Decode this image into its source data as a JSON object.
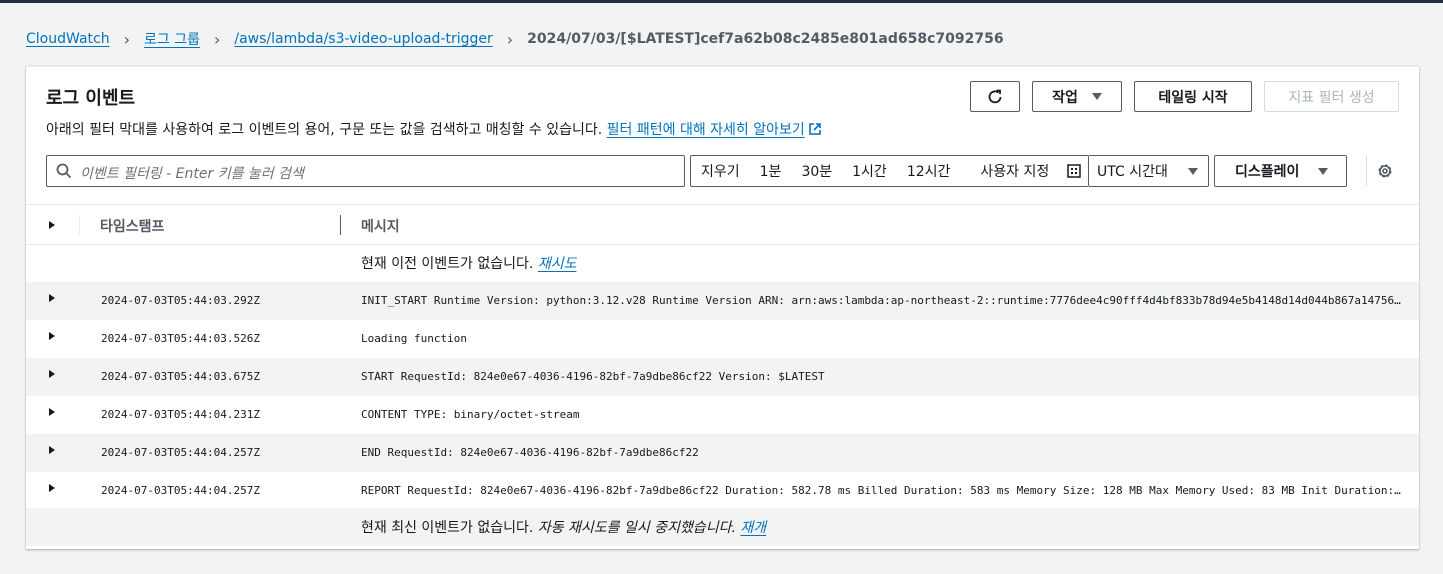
{
  "breadcrumb": {
    "items": [
      "CloudWatch",
      "로그 그룹",
      "/aws/lambda/s3-video-upload-trigger"
    ],
    "current": "2024/07/03/[$LATEST]cef7a62b08c2485e801ad658c7092756"
  },
  "panel": {
    "title": "로그 이벤트",
    "description": "아래의 필터 막대를 사용하여 로그 이벤트의 용어, 구문 또는 값을 검색하고 매칭할 수 있습니다.",
    "learn_link": "필터 패턴에 대해 자세히 알아보기"
  },
  "buttons": {
    "actions": "작업",
    "tailing": "테일링 시작",
    "create_metric_filter": "지표 필터 생성"
  },
  "search": {
    "placeholder": "이벤트 필터링 - Enter 키를 눌러 검색"
  },
  "time_range": {
    "clear": "지우기",
    "options": [
      "1분",
      "30분",
      "1시간",
      "12시간"
    ],
    "custom": "사용자 지정"
  },
  "timezone": "UTC 시간대",
  "display": "디스플레이",
  "table": {
    "columns": [
      "타임스탬프",
      "메시지"
    ],
    "top_notice": "현재 이전 이벤트가 없습니다.",
    "top_retry": "재시도",
    "rows": [
      {
        "timestamp": "2024-07-03T05:44:03.292Z",
        "message": "INIT_START Runtime Version: python:3.12.v28 Runtime Version ARN: arn:aws:lambda:ap-northeast-2::runtime:7776dee4c90fff4d4bf833b78d94e5b4148d14d044b867a14756..."
      },
      {
        "timestamp": "2024-07-03T05:44:03.526Z",
        "message": "Loading function"
      },
      {
        "timestamp": "2024-07-03T05:44:03.675Z",
        "message": "START RequestId: 824e0e67-4036-4196-82bf-7a9dbe86cf22 Version: $LATEST"
      },
      {
        "timestamp": "2024-07-03T05:44:04.231Z",
        "message": "CONTENT TYPE: binary/octet-stream"
      },
      {
        "timestamp": "2024-07-03T05:44:04.257Z",
        "message": "END RequestId: 824e0e67-4036-4196-82bf-7a9dbe86cf22"
      },
      {
        "timestamp": "2024-07-03T05:44:04.257Z",
        "message": "REPORT RequestId: 824e0e67-4036-4196-82bf-7a9dbe86cf22 Duration: 582.78 ms Billed Duration: 583 ms Memory Size: 128 MB Max Memory Used: 83 MB Init Duration:..."
      }
    ],
    "bottom_notice": "현재 최신 이벤트가 없습니다.",
    "bottom_paused": "자동 재시도를 일시 중지했습니다.",
    "bottom_resume": "재개"
  },
  "colors": {
    "link": "#0073bb",
    "nav_bar": "#232f3e",
    "alt_row": "#f2f3f3"
  },
  "icons": [
    "chevron-right-icon",
    "external-link-icon",
    "refresh-icon",
    "caret-down-icon",
    "search-icon",
    "calendar-icon",
    "gear-icon",
    "expand-triangle-icon"
  ]
}
